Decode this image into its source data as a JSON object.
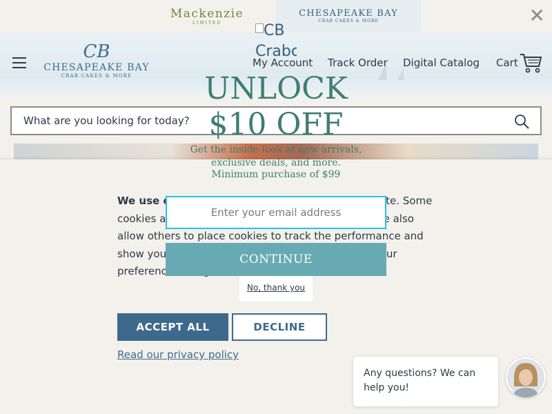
{
  "brands": {
    "mackenzie": {
      "name": "Mackenzie",
      "tag": "LIMITED"
    },
    "chesapeake": {
      "name": "CHESAPEAKE BAY",
      "tag": "CRAB CAKES & MORE"
    }
  },
  "header": {
    "logo_monogram": "CB",
    "logo_name": "CHESAPEAKE BAY",
    "logo_tag": "CRAB CAKES & MORE",
    "nav": {
      "account": "My Account",
      "track": "Track Order",
      "catalog": "Digital Catalog",
      "cart": "Cart"
    }
  },
  "search": {
    "placeholder": "What are you looking for today?"
  },
  "cookie": {
    "text_bold": "We use c",
    "text_rest": "ookies to enhance and improve our website. Some cookies are essential and can't be turned off, but we also allow others to place cookies to track the performance and show you personalized content and ads. Manage your preferences using the buttons.",
    "accept_label": "ACCEPT ALL",
    "decline_label": "DECLINE",
    "privacy_label": "Read our privacy policy"
  },
  "promo": {
    "image_alt": "CB Crabcakes",
    "headline_1": "UNLOCK",
    "headline_2": "$10 OFF",
    "sub_1": "Get the inside look at new arrivals,",
    "sub_2": "exclusive deals, and more.",
    "minimum": "Minimum purchase of $99",
    "email_placeholder": "Enter your email address",
    "continue_label": "CONTINUE",
    "no_thanks_label": "No, thank you"
  },
  "chat": {
    "message": "Any questions? We can help you!"
  },
  "colors": {
    "brand_blue": "#3d6a8c",
    "promo_green": "#3e7e70",
    "continue_teal": "#68aab3",
    "email_border": "#25c4e0"
  }
}
